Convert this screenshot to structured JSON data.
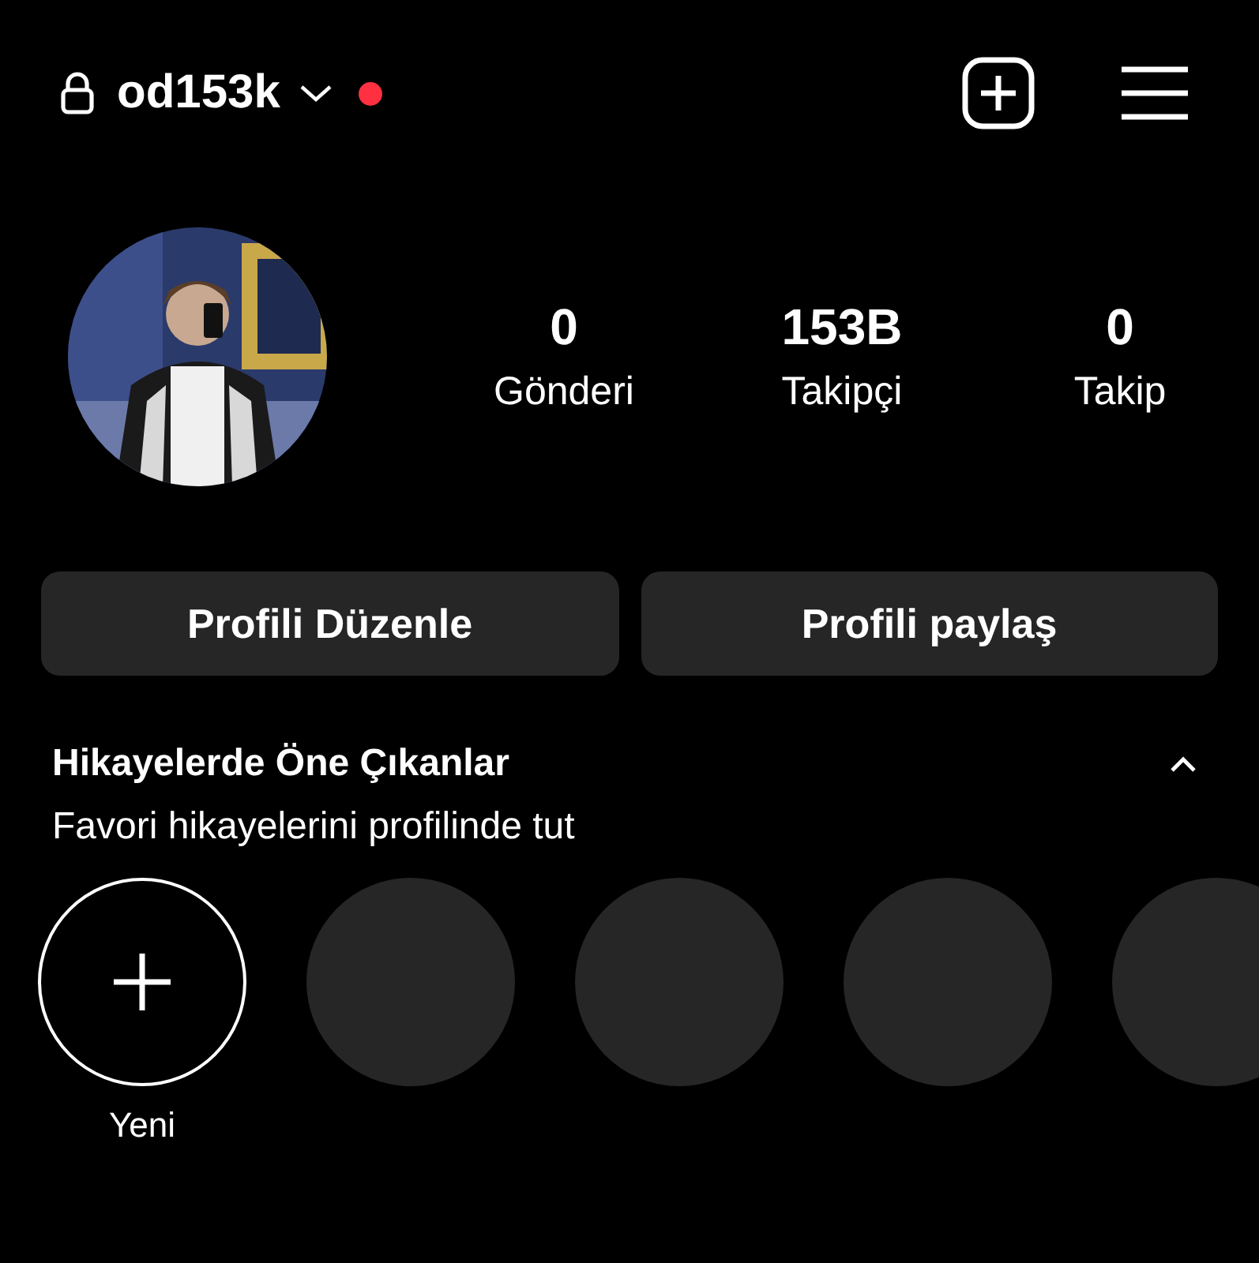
{
  "header": {
    "username": "od153k",
    "private": true,
    "unread": true
  },
  "profile": {
    "avatar": {
      "kind": "picture"
    }
  },
  "stats": [
    {
      "value": "0",
      "label": "Gönderi"
    },
    {
      "value": "153B",
      "label": "Takipçi"
    },
    {
      "value": "0",
      "label": "Takip"
    }
  ],
  "buttons": [
    "Profili Düzenle",
    "Profili paylaş"
  ],
  "highlights": {
    "title": "Hikayelerde Öne Çıkanlar",
    "subtitle": "Favori hikayelerini profilinde tut",
    "expanded": true,
    "items": [
      {
        "kind": "new",
        "label": "Yeni"
      },
      {
        "kind": "empty"
      },
      {
        "kind": "empty"
      },
      {
        "kind": "empty"
      },
      {
        "kind": "empty"
      }
    ]
  }
}
